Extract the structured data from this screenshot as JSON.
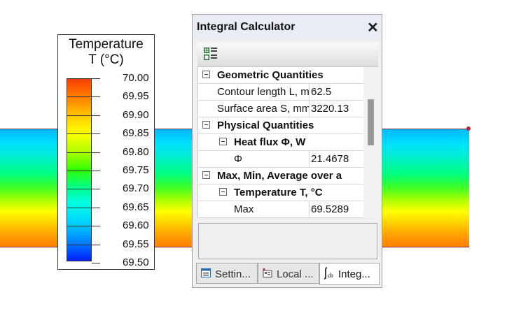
{
  "legend": {
    "title_line1": "Temperature",
    "title_line2": "T (°C)",
    "labels": [
      "70.00",
      "69.95",
      "69.90",
      "69.85",
      "69.80",
      "69.75",
      "69.70",
      "69.65",
      "69.60",
      "69.55",
      "69.50"
    ]
  },
  "panel": {
    "title": "Integral Calculator",
    "close_icon": "close-icon",
    "toolbar_icon": "calculator-grid-icon",
    "tree": {
      "geometric": {
        "label": "Geometric Quantities",
        "contour_label": "Contour length L, m",
        "contour_value": "62.5",
        "surface_label": "Surface area S, mm",
        "surface_value": "3220.13"
      },
      "physical": {
        "label": "Physical Quantities",
        "heat_flux_label": "Heat flux Φ, W",
        "phi_label": "Φ",
        "phi_value": "21.4678"
      },
      "maxmin": {
        "label": "Max, Min, Average over a",
        "temperature_label": "Temperature T, °C",
        "max_label": "Max",
        "max_value": "69.5289"
      }
    },
    "tabs": [
      {
        "label": "Settin...",
        "icon": "settings-icon"
      },
      {
        "label": "Local ...",
        "icon": "local-values-icon"
      },
      {
        "label": "Integ...",
        "icon": "integral-icon"
      }
    ]
  },
  "colors": {
    "panel_bg": "#f0f0f0",
    "titlebar_bg": "#e8ecf4",
    "field_border": "#8b2d3a"
  }
}
